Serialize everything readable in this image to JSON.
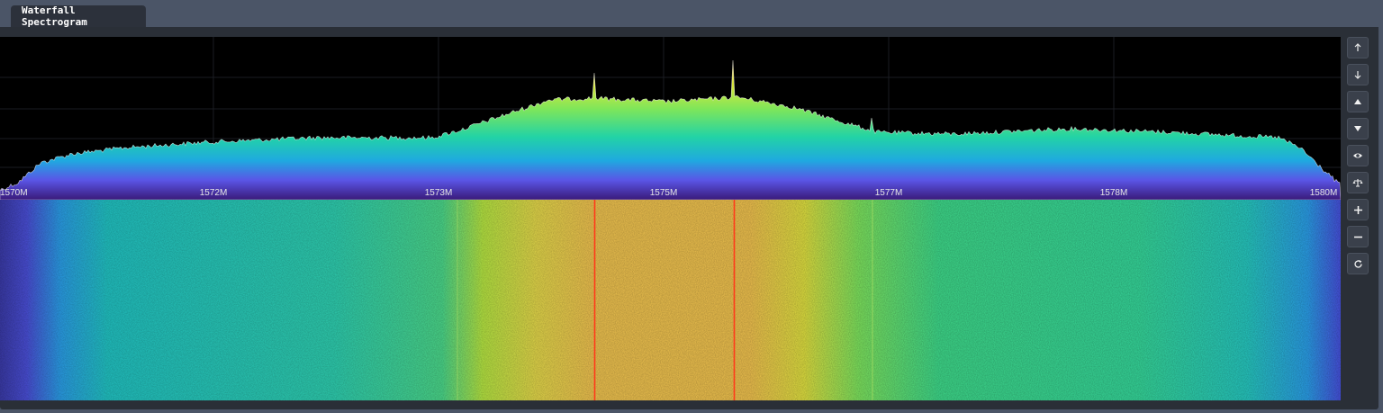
{
  "tab": {
    "label": "Waterfall Spectrogram"
  },
  "axis": {
    "ticks": [
      "1570M",
      "1572M",
      "1573M",
      "1575M",
      "1577M",
      "1578M",
      "1580M"
    ]
  },
  "toolbar": {
    "buttons": [
      {
        "name": "scroll-up-button",
        "icon": "arrow-up-icon"
      },
      {
        "name": "scroll-down-button",
        "icon": "arrow-down-icon"
      },
      {
        "name": "level-up-button",
        "icon": "triangle-up-icon"
      },
      {
        "name": "level-down-button",
        "icon": "triangle-down-icon"
      },
      {
        "name": "visibility-button",
        "icon": "eye-icon"
      },
      {
        "name": "balance-button",
        "icon": "scale-icon"
      },
      {
        "name": "zoom-in-button",
        "icon": "plus-icon"
      },
      {
        "name": "zoom-out-button",
        "icon": "minus-icon"
      },
      {
        "name": "reset-button",
        "icon": "refresh-icon"
      }
    ]
  },
  "colors": {
    "panel": "#2a2f37",
    "background": "#4b5567",
    "marker": "#ff3a1a"
  }
}
